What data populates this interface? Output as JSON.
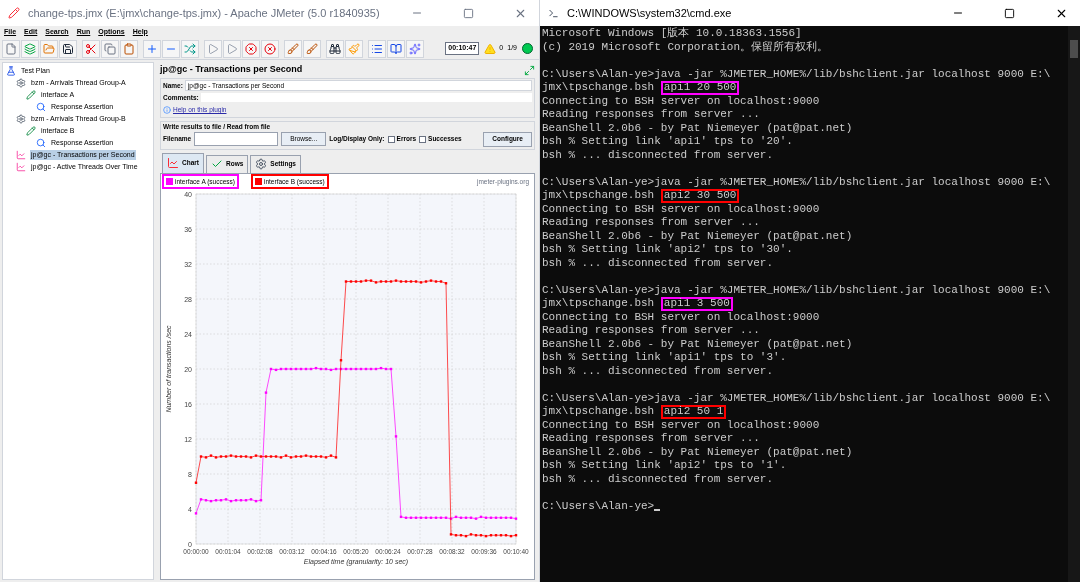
{
  "jmeter": {
    "title": "change-tps.jmx (E:\\jmx\\change-tps.jmx) - Apache JMeter (5.0 r1840935)",
    "menu": [
      "File",
      "Edit",
      "Search",
      "Run",
      "Options",
      "Help"
    ],
    "toolbar": {
      "timer": "00:10:47",
      "warnings": "0",
      "threads": "1/9"
    },
    "tree": [
      {
        "label": "Test Plan",
        "kind": "plan",
        "selected": false,
        "children": [
          {
            "label": "bzm - Arrivals Thread Group-A",
            "kind": "group",
            "selected": false,
            "children": [
              {
                "label": "interface A",
                "kind": "sampler",
                "selected": false,
                "children": [
                  {
                    "label": "Response Assertion",
                    "kind": "assertion",
                    "selected": false
                  }
                ]
              }
            ]
          },
          {
            "label": "bzm - Arrivals Thread Group-B",
            "kind": "group",
            "selected": false,
            "children": [
              {
                "label": "interface B",
                "kind": "sampler",
                "selected": false,
                "children": [
                  {
                    "label": "Response Assertion",
                    "kind": "assertion",
                    "selected": false
                  }
                ]
              }
            ]
          },
          {
            "label": "jp@gc - Transactions per Second",
            "kind": "listener",
            "selected": true
          },
          {
            "label": "jp@gc - Active Threads Over Time",
            "kind": "listener",
            "selected": false
          }
        ]
      }
    ],
    "panel": {
      "title": "jp@gc - Transactions per Second",
      "name_label": "Name:",
      "name_value": "jp@gc - Transactions per Second",
      "comments_label": "Comments:",
      "help_link": "Help on this plugin",
      "file_group_title": "Write results to file / Read from file",
      "filename_label": "Filename",
      "browse": "Browse...",
      "log_label": "Log/Display Only:",
      "errors": {
        "label": "Errors",
        "checked": false
      },
      "successes": {
        "label": "Successes",
        "checked": false
      },
      "configure": "Configure",
      "tabs": [
        {
          "label": "Chart",
          "kind": "chart",
          "selected": true
        },
        {
          "label": "Rows",
          "kind": "rows",
          "selected": false
        },
        {
          "label": "Settings",
          "kind": "settings",
          "selected": false
        }
      ],
      "chart_credit": "jmeter-plugins.org",
      "chart_data": {
        "type": "line",
        "grid": true,
        "xlabel": "Elapsed time (granularity: 10 sec)",
        "ylabel": "Number of transactions /sec",
        "x": [
          0,
          10,
          20,
          30,
          40,
          50,
          60,
          70,
          80,
          90,
          100,
          110,
          120,
          130,
          140,
          150,
          160,
          170,
          180,
          190,
          200,
          210,
          220,
          230,
          240,
          250,
          260,
          270,
          280,
          290,
          300,
          310,
          320,
          330,
          340,
          350,
          360,
          370,
          380,
          390,
          400,
          410,
          420,
          430,
          440,
          450,
          460,
          470,
          480,
          490,
          500,
          510,
          520,
          530,
          540,
          550,
          560,
          570,
          580,
          590,
          600,
          610,
          620,
          630,
          640
        ],
        "xlim": [
          0,
          640
        ],
        "ylim": [
          0,
          40
        ],
        "xticks": [
          {
            "value": 0,
            "label": "00:00:00"
          },
          {
            "value": 64,
            "label": "00:01:04"
          },
          {
            "value": 128,
            "label": "00:02:08"
          },
          {
            "value": 192,
            "label": "00:03:12"
          },
          {
            "value": 256,
            "label": "00:04:16"
          },
          {
            "value": 320,
            "label": "00:05:20"
          },
          {
            "value": 384,
            "label": "00:06:24"
          },
          {
            "value": 448,
            "label": "00:07:28"
          },
          {
            "value": 512,
            "label": "00:08:32"
          },
          {
            "value": 576,
            "label": "00:09:36"
          },
          {
            "value": 640,
            "label": "00:10:40"
          }
        ],
        "yticks": [
          0,
          4,
          8,
          12,
          16,
          20,
          24,
          28,
          32,
          36,
          40
        ],
        "series": [
          {
            "name": "interface A (success)",
            "color": "#ff00ff",
            "marker": "square",
            "values": [
              3.5,
              5.1,
              5,
              4.9,
              5,
              5,
              5.1,
              4.9,
              5,
              5,
              5,
              5.1,
              4.9,
              5,
              17.3,
              20,
              19.9,
              20,
              20,
              20,
              20,
              20,
              20,
              20,
              20.1,
              20,
              20,
              19.9,
              20,
              20,
              20,
              20,
              20,
              20,
              20,
              20,
              20,
              20.1,
              20,
              20,
              12.3,
              3.1,
              3,
              3,
              3,
              3,
              3,
              3,
              3,
              3,
              3,
              2.9,
              3.1,
              3,
              3,
              3,
              2.9,
              3.1,
              3,
              3,
              3,
              3,
              3,
              3,
              2.9
            ]
          },
          {
            "name": "interface B (success)",
            "color": "#ff0000",
            "marker": "square",
            "values": [
              7,
              10,
              9.9,
              10.1,
              9.9,
              10,
              10,
              10.1,
              10,
              10,
              10,
              9.9,
              10.1,
              10,
              10,
              10,
              10,
              9.9,
              10.1,
              9.9,
              10,
              10,
              10.1,
              10,
              10,
              10,
              9.9,
              10.1,
              9.9,
              21,
              30,
              30,
              30,
              30,
              30.1,
              30.1,
              29.9,
              30,
              30,
              30,
              30.1,
              30,
              30,
              30,
              30,
              29.9,
              30,
              30.1,
              30,
              30,
              29.8,
              1.1,
              1,
              1,
              0.9,
              1.1,
              1,
              1,
              0.9,
              1,
              1,
              1,
              1,
              0.9,
              1
            ]
          }
        ]
      }
    }
  },
  "cmd": {
    "title": "C:\\WINDOWS\\system32\\cmd.exe",
    "lines": [
      {
        "text": "Microsoft Windows [版本 10.0.18363.1556]"
      },
      {
        "text": "(c) 2019 Microsoft Corporation。保留所有权利。"
      },
      {
        "kind": "blank"
      },
      {
        "text": "C:\\Users\\Alan-ye>java -jar %JMETER_HOME%/lib/bshclient.jar localhost 9000 E:\\"
      },
      {
        "text": "jmx\\tpschange.bsh ",
        "mark": "api1 20 500",
        "color": "#ff00ff"
      },
      {
        "text": "Connecting to BSH server on localhost:9000"
      },
      {
        "text": "Reading responses from server ..."
      },
      {
        "text": "BeanShell 2.0b6 - by Pat Niemeyer (pat@pat.net)"
      },
      {
        "text": "bsh % Setting link 'api1' tps to '20'."
      },
      {
        "text": "bsh % ... disconnected from server."
      },
      {
        "kind": "blank"
      },
      {
        "text": "C:\\Users\\Alan-ye>java -jar %JMETER_HOME%/lib/bshclient.jar localhost 9000 E:\\"
      },
      {
        "text": "jmx\\tpschange.bsh ",
        "mark": "api2 30 500",
        "color": "#ff0000"
      },
      {
        "text": "Connecting to BSH server on localhost:9000"
      },
      {
        "text": "Reading responses from server ..."
      },
      {
        "text": "BeanShell 2.0b6 - by Pat Niemeyer (pat@pat.net)"
      },
      {
        "text": "bsh % Setting link 'api2' tps to '30'."
      },
      {
        "text": "bsh % ... disconnected from server."
      },
      {
        "kind": "blank"
      },
      {
        "text": "C:\\Users\\Alan-ye>java -jar %JMETER_HOME%/lib/bshclient.jar localhost 9000 E:\\"
      },
      {
        "text": "jmx\\tpschange.bsh ",
        "mark": "api1 3 500",
        "color": "#ff00ff"
      },
      {
        "text": "Connecting to BSH server on localhost:9000"
      },
      {
        "text": "Reading responses from server ..."
      },
      {
        "text": "BeanShell 2.0b6 - by Pat Niemeyer (pat@pat.net)"
      },
      {
        "text": "bsh % Setting link 'api1' tps to '3'."
      },
      {
        "text": "bsh % ... disconnected from server."
      },
      {
        "kind": "blank"
      },
      {
        "text": "C:\\Users\\Alan-ye>java -jar %JMETER_HOME%/lib/bshclient.jar localhost 9000 E:\\"
      },
      {
        "text": "jmx\\tpschange.bsh ",
        "mark": "api2 50 1",
        "color": "#ff0000"
      },
      {
        "text": "Connecting to BSH server on localhost:9000"
      },
      {
        "text": "Reading responses from server ..."
      },
      {
        "text": "BeanShell 2.0b6 - by Pat Niemeyer (pat@pat.net)"
      },
      {
        "text": "bsh % Setting link 'api2' tps to '1'."
      },
      {
        "text": "bsh % ... disconnected from server."
      },
      {
        "kind": "blank"
      },
      {
        "text": "C:\\Users\\Alan-ye>",
        "kind": "prompt"
      }
    ]
  }
}
